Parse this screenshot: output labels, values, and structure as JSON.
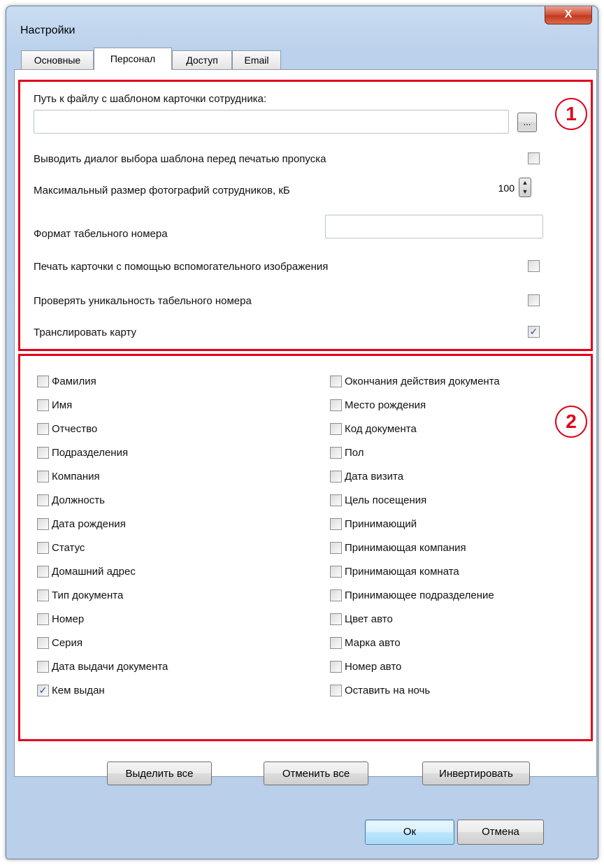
{
  "window": {
    "title": "Настройки",
    "close_glyph": "X"
  },
  "tabs": [
    {
      "label": "Основные"
    },
    {
      "label": "Персонал"
    },
    {
      "label": "Доступ"
    },
    {
      "label": "Email"
    }
  ],
  "active_tab": "Персонал",
  "section1": {
    "badge": "1",
    "template_path_label": "Путь к файлу с шаблоном карточки сотрудника:",
    "template_path_value": "",
    "browse_label": "...",
    "show_dialog_label": "Выводить диалог выбора шаблона перед печатью пропуска",
    "show_dialog_checked": false,
    "max_photo_label": "Максимальный размер фотографий сотрудников, кБ",
    "max_photo_value": "100",
    "tab_format_label": "Формат табельного номера",
    "tab_format_value": "",
    "print_aux_label": "Печать карточки с помощью вспомогательного изображения",
    "print_aux_checked": false,
    "check_unique_label": "Проверять уникальность табельного номера",
    "check_unique_checked": false,
    "translate_label": "Транслировать карту",
    "translate_checked": true
  },
  "section2": {
    "badge": "2",
    "left_fields": [
      {
        "label": "Фамилия",
        "checked": false
      },
      {
        "label": "Имя",
        "checked": false
      },
      {
        "label": "Отчество",
        "checked": false
      },
      {
        "label": "Подразделения",
        "checked": false
      },
      {
        "label": "Компания",
        "checked": false
      },
      {
        "label": "Должность",
        "checked": false
      },
      {
        "label": "Дата рождения",
        "checked": false
      },
      {
        "label": "Статус",
        "checked": false
      },
      {
        "label": "Домашний адрес",
        "checked": false
      },
      {
        "label": "Тип документа",
        "checked": false
      },
      {
        "label": "Номер",
        "checked": false
      },
      {
        "label": "Серия",
        "checked": false
      },
      {
        "label": "Дата выдачи документа",
        "checked": false
      },
      {
        "label": "Кем выдан",
        "checked": true
      }
    ],
    "right_fields": [
      {
        "label": "Окончания действия документа",
        "checked": false
      },
      {
        "label": "Место рождения",
        "checked": false
      },
      {
        "label": "Код документа",
        "checked": false
      },
      {
        "label": "Пол",
        "checked": false
      },
      {
        "label": "Дата визита",
        "checked": false
      },
      {
        "label": "Цель посещения",
        "checked": false
      },
      {
        "label": "Принимающий",
        "checked": false
      },
      {
        "label": "Принимающая компания",
        "checked": false
      },
      {
        "label": "Принимающая комната",
        "checked": false
      },
      {
        "label": "Принимающее подразделение",
        "checked": false
      },
      {
        "label": "Цвет авто",
        "checked": false
      },
      {
        "label": "Марка авто",
        "checked": false
      },
      {
        "label": "Номер авто",
        "checked": false
      },
      {
        "label": "Оставить на ночь",
        "checked": false
      }
    ],
    "select_all_label": "Выделить все",
    "deselect_all_label": "Отменить все",
    "invert_label": "Инвертировать"
  },
  "footer": {
    "ok_label": "Ок",
    "cancel_label": "Отмена"
  },
  "icons": {
    "check_glyph": "✓",
    "spin_up": "▲",
    "spin_down": "▼"
  },
  "colors": {
    "highlight": "#e0001b",
    "window_frame": "#b9cfea",
    "check": "#2b4ea1"
  }
}
